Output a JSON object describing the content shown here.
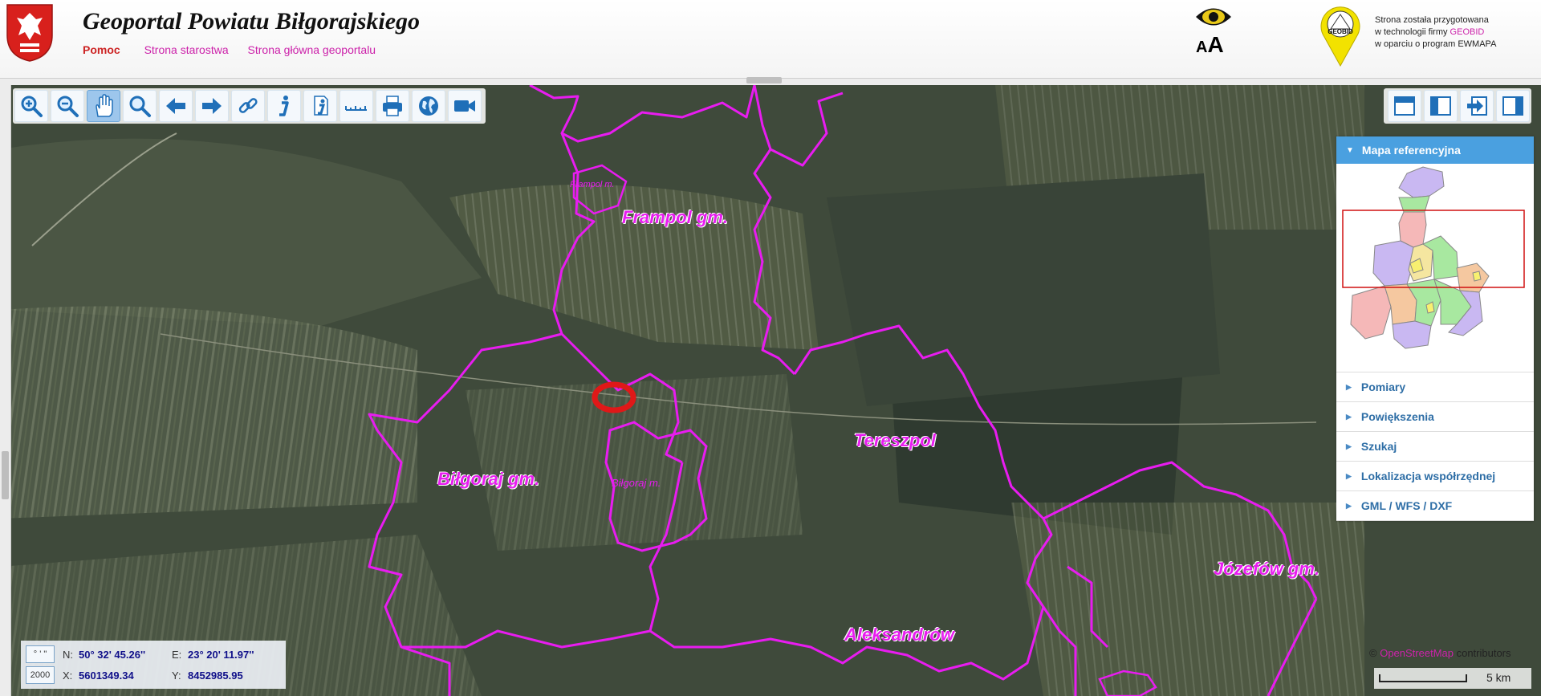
{
  "header": {
    "title": "Geoportal Powiatu Biłgorajskiego",
    "links": [
      "Pomoc",
      "Strona starostwa",
      "Strona główna geoportalu"
    ],
    "accessibility_font_label": "A",
    "accessibility_font_label_large": "A",
    "geobid": {
      "logo_text": "GEOBID",
      "line1": "Strona została przygotowana",
      "line2_prefix": "w technologii firmy ",
      "line2_highlight": "GEOBID",
      "line3": "w oparciu o program EWMAPA"
    }
  },
  "toolbar": {
    "tools": [
      {
        "name": "zoom-in-tool",
        "icon": "zoom-in-icon"
      },
      {
        "name": "zoom-out-tool",
        "icon": "zoom-out-icon"
      },
      {
        "name": "pan-tool",
        "icon": "hand-icon",
        "active": true
      },
      {
        "name": "zoom-extent-tool",
        "icon": "magnifier-icon"
      },
      {
        "name": "back-tool",
        "icon": "arrow-left-icon"
      },
      {
        "name": "forward-tool",
        "icon": "arrow-right-icon"
      },
      {
        "name": "link-tool",
        "icon": "link-icon"
      },
      {
        "name": "info-tool",
        "icon": "info-icon"
      },
      {
        "name": "info-extended-tool",
        "icon": "info-document-icon"
      },
      {
        "name": "measure-tool",
        "icon": "ruler-icon"
      },
      {
        "name": "print-tool",
        "icon": "printer-icon"
      },
      {
        "name": "globe-tool",
        "icon": "globe-icon"
      },
      {
        "name": "video-tool",
        "icon": "camera-icon"
      }
    ]
  },
  "right_toolbar": {
    "tools": [
      {
        "name": "layout-top-button",
        "icon": "layout-top-icon"
      },
      {
        "name": "layout-left-button",
        "icon": "layout-left-icon"
      },
      {
        "name": "export-button",
        "icon": "arrow-into-box-icon"
      },
      {
        "name": "layout-right-button",
        "icon": "layout-right-icon"
      }
    ]
  },
  "panel": {
    "header": "Mapa referencyjna",
    "items": [
      "Pomiary",
      "Powiększenia",
      "Szukaj",
      "Lokalizacja współrzędnej",
      "GML / WFS / DXF"
    ]
  },
  "map_labels": [
    "Frampol gm.",
    "Biłgoraj gm.",
    "Tereszpol",
    "Józefów gm.",
    "Aleksandrów",
    "Biłgoraj m.",
    "Frampol m."
  ],
  "coords": {
    "dms_button": "° ' \"",
    "grid_button": "2000",
    "n_label": "N:",
    "n_value": "50° 32' 45.26''",
    "e_label": "E:",
    "e_value": "23° 20' 11.97''",
    "x_label": "X:",
    "x_value": "5601349.34",
    "y_label": "Y:",
    "y_value": "8452985.95"
  },
  "attribution": {
    "prefix": "© ",
    "highlight": "OpenStreetMap",
    "suffix": " contributors"
  },
  "scale": "5 km",
  "colors": {
    "boundary": "#e81cf0",
    "marker": "#e01818",
    "panel_header": "#4aa0e0",
    "link": "#cc22aa"
  }
}
